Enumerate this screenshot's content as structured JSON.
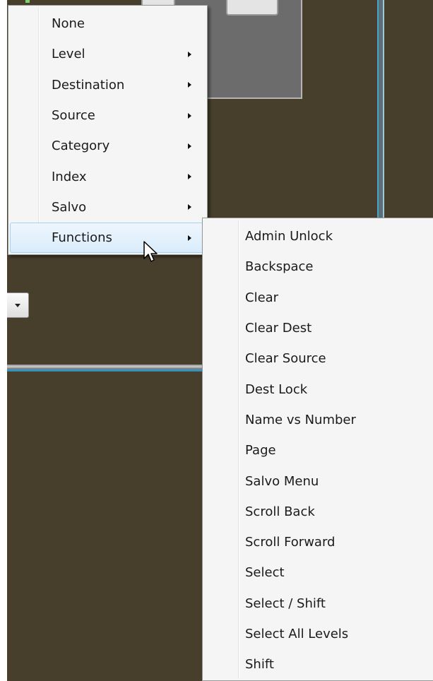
{
  "menu": {
    "items": [
      {
        "label": "None",
        "has_submenu": false,
        "highlighted": false
      },
      {
        "label": "Level",
        "has_submenu": true,
        "highlighted": false
      },
      {
        "label": "Destination",
        "has_submenu": true,
        "highlighted": false
      },
      {
        "label": "Source",
        "has_submenu": true,
        "highlighted": false
      },
      {
        "label": "Category",
        "has_submenu": true,
        "highlighted": false
      },
      {
        "label": "Index",
        "has_submenu": true,
        "highlighted": false
      },
      {
        "label": "Salvo",
        "has_submenu": true,
        "highlighted": false
      },
      {
        "label": "Functions",
        "has_submenu": true,
        "highlighted": true
      }
    ]
  },
  "submenu": {
    "items": [
      {
        "label": "Admin Unlock"
      },
      {
        "label": "Backspace"
      },
      {
        "label": "Clear"
      },
      {
        "label": "Clear Dest"
      },
      {
        "label": "Clear Source"
      },
      {
        "label": "Dest Lock"
      },
      {
        "label": "Name vs Number"
      },
      {
        "label": "Page"
      },
      {
        "label": "Salvo Menu"
      },
      {
        "label": "Scroll Back"
      },
      {
        "label": "Scroll Forward"
      },
      {
        "label": "Select"
      },
      {
        "label": "Select / Shift"
      },
      {
        "label": "Select All Levels"
      },
      {
        "label": "Shift"
      }
    ]
  },
  "icons": {
    "submenu_arrow": "triangle-right-icon",
    "dropdown": "chevron-down-icon",
    "cursor": "arrow-cursor-icon"
  },
  "colors": {
    "app_background": "#473f2c",
    "menu_background": "#f5f5f5",
    "highlight_border": "#a7d1f1",
    "frame_accent": "#3a9bc4"
  }
}
